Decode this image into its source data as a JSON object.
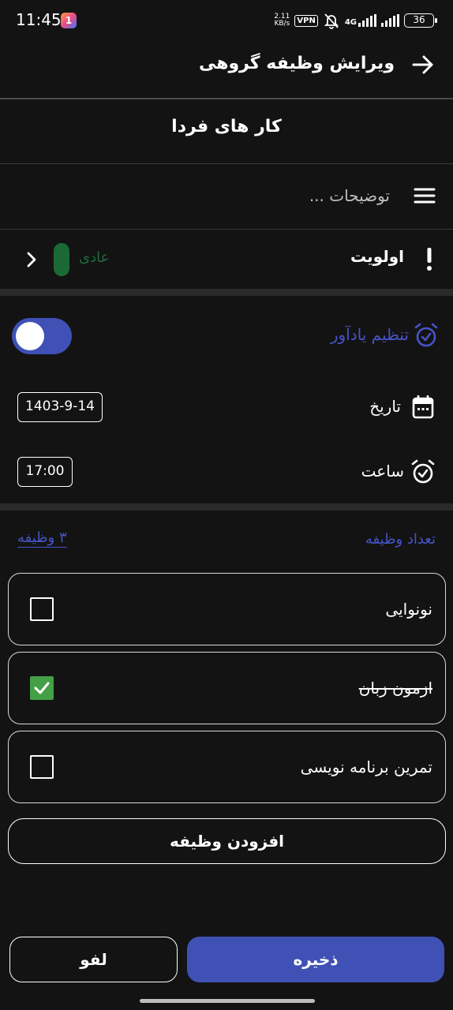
{
  "status_bar": {
    "time": "11:45",
    "app_badge": "1",
    "net_speed_value": "2.11",
    "net_speed_unit": "KB/s",
    "vpn": "VPN",
    "network_type": "4G",
    "battery": "36"
  },
  "header": {
    "title": "ویرایش وظیفه گروهی",
    "back_icon": "arrow-right-icon"
  },
  "task": {
    "title": "کار های فردا",
    "description_placeholder": "توضیحات ..."
  },
  "priority": {
    "label": "اولویت",
    "value": "عادی",
    "color": "#1b6a35"
  },
  "reminder": {
    "label": "تنظیم یادآور",
    "enabled": true,
    "accent": "#4654c9"
  },
  "date": {
    "label": "تاریخ",
    "value": "1403-9-14"
  },
  "time": {
    "label": "ساعت",
    "value": "17:00"
  },
  "tasks_count": {
    "label": "تعداد وظیفه",
    "value": "۳ وظیفه"
  },
  "subtasks": [
    {
      "text": "نونوایی",
      "checked": false
    },
    {
      "text": "ازمون زبان",
      "checked": true
    },
    {
      "text": "تمرین برنامه نویسی",
      "checked": false
    }
  ],
  "actions": {
    "add_task": "افزودن وظیفه",
    "save": "ذخیره",
    "cancel": "لفو"
  },
  "colors": {
    "background": "#131313",
    "primary": "#3f51b5",
    "check_green": "#43a047"
  }
}
